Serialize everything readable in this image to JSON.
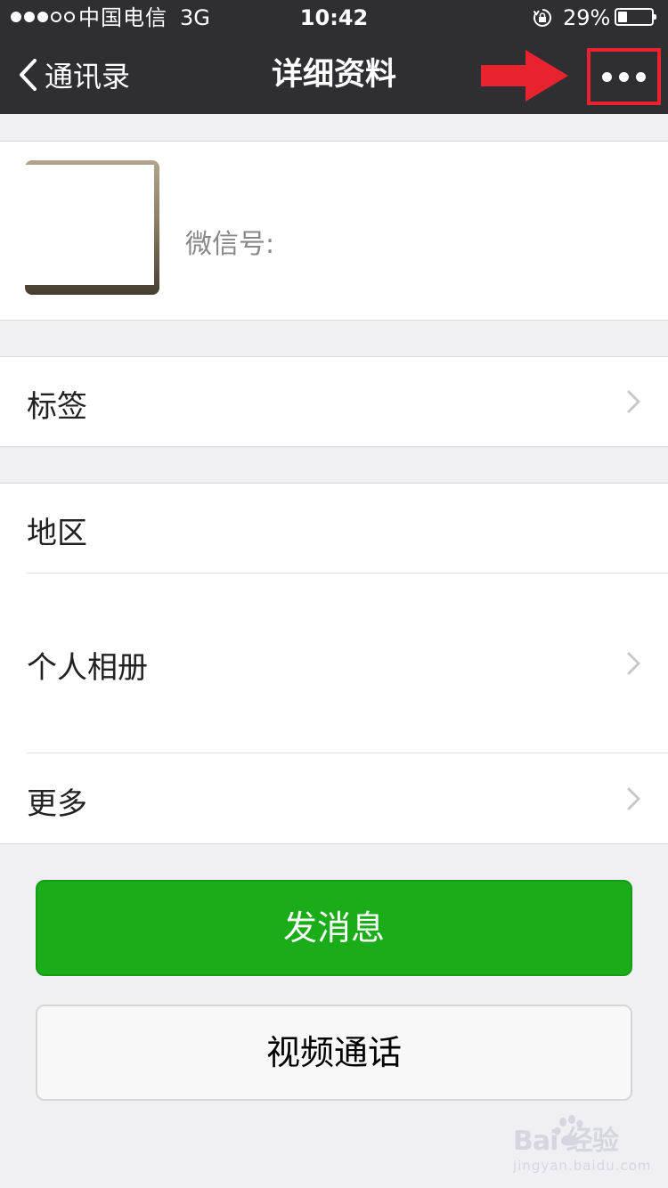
{
  "status_bar": {
    "carrier": "中国电信",
    "network": "3G",
    "time": "10:42",
    "battery": "29%",
    "battery_level": 0.29
  },
  "nav": {
    "back_label": "通讯录",
    "title": "详细资料",
    "more_glyph": "•••"
  },
  "annotation": {
    "color": "#e8232e"
  },
  "profile": {
    "wechat_id_label": "微信号:"
  },
  "cells": {
    "tags": "标签",
    "region": "地区",
    "album": "个人相册",
    "more": "更多"
  },
  "buttons": {
    "send_message": "发消息",
    "video_call": "视频通话"
  },
  "colors": {
    "nav_bg": "#2e2e33",
    "page_bg": "#efeff4",
    "primary_green": "#1aad19"
  },
  "watermark": {
    "logo_text": "Bai  经验",
    "site": "jingyan.baidu.com"
  }
}
